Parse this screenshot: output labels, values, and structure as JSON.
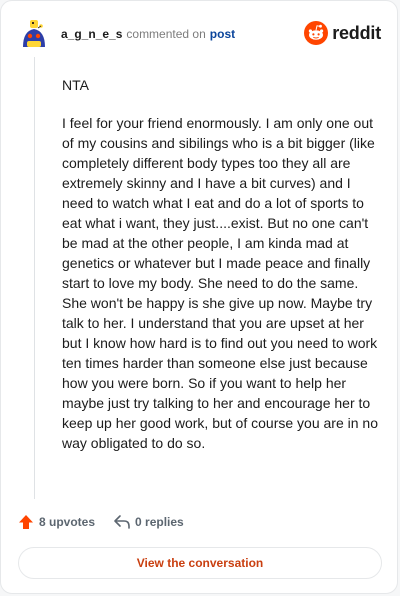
{
  "header": {
    "username": "a_g_n_e_s",
    "commented_text": "commented on",
    "post_link": "post",
    "brand": "reddit"
  },
  "comment": {
    "paragraphs": [
      "NTA",
      "I feel for your friend enormously. I am only one out of my cousins and sibilings who is a bit bigger (like completely different body types too they all are extremely skinny and I have a bit curves) and I need to watch what I eat and do a lot of sports to eat what i want, they just....exist. But no one can't be mad at the other people, I am kinda mad at genetics or whatever but I made peace and finally start to love my body. She need to do the same. She won't be happy is she give up now. Maybe try talk to her. I understand that you are upset at her but I know how hard is to find out you need to work ten times harder than someone else just because how you were born. So if you want to help her maybe just try talking to her and encourage her to keep up her good work, but of course you are in no way obligated to do so."
    ]
  },
  "actions": {
    "upvotes": "8 upvotes",
    "replies": "0 replies"
  },
  "footer": {
    "view_conversation": "View the conversation"
  },
  "colors": {
    "brand_orange": "#ff4500",
    "link_blue": "#0a449b",
    "button_text": "#c93f10"
  },
  "icons": {
    "avatar": "snoo-avatar",
    "brand": "reddit-logo-icon",
    "upvote": "upvote-arrow-icon",
    "reply": "reply-arrow-icon"
  }
}
